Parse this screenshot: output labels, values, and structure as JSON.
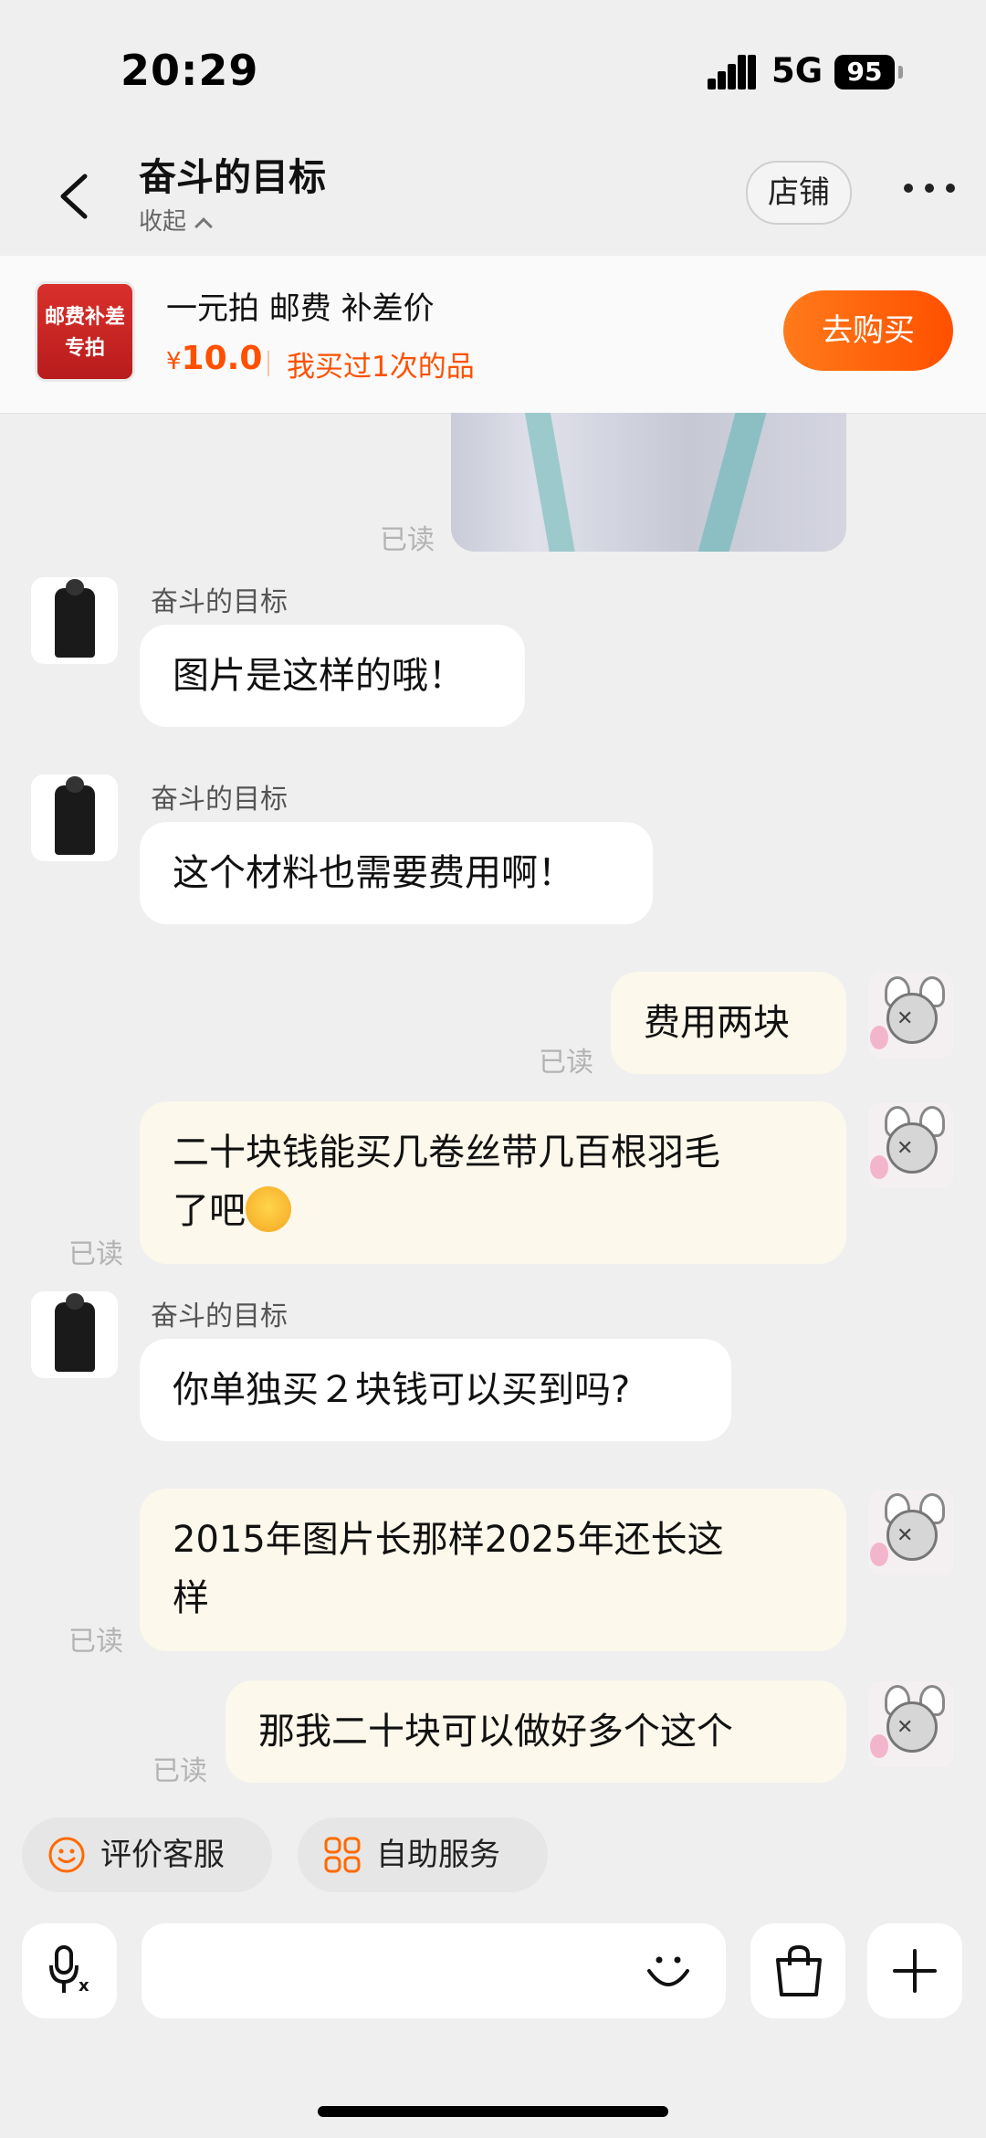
{
  "status_bar": {
    "time": "20:29",
    "network": "5G",
    "battery": "95"
  },
  "header": {
    "title": "奋斗的目标",
    "collapse_label": "收起",
    "store_button": "店铺"
  },
  "product": {
    "image_text_line1": "邮费补差",
    "image_text_line2": "专拍",
    "name": "一元拍 邮费 补差价",
    "price_symbol": "¥",
    "price": "10.0",
    "bought_note": "我买过1次的品",
    "buy_button": "去购买"
  },
  "messages": {
    "read_label": "已读",
    "sender_name": "奋斗的目标",
    "m1": "图片是这样的哦！",
    "m2": "这个材料也需要费用啊！",
    "m3": "费用两块",
    "m4_line1": "二十块钱能买几卷丝带几百根羽毛",
    "m4_line2": "了吧",
    "m5": "你单独买２块钱可以买到吗?",
    "m6_line1": "2015年图片长那样2025年还长这",
    "m6_line2": "样",
    "m7": "那我二十块可以做好多个这个"
  },
  "quick_actions": {
    "rate_service": "评价客服",
    "self_service": "自助服务"
  },
  "colors": {
    "accent": "#ff5000",
    "user_bubble": "#fcf8eb",
    "background": "#efefef"
  }
}
